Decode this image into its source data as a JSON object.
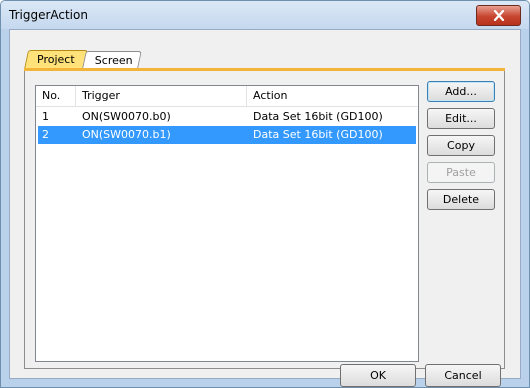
{
  "window": {
    "title": "TriggerAction"
  },
  "tabs": [
    {
      "label": "Project"
    },
    {
      "label": "Screen"
    }
  ],
  "table": {
    "columns": [
      "No.",
      "Trigger",
      "Action"
    ],
    "rows": [
      {
        "no": "1",
        "trigger": "ON(SW0070.b0)",
        "action": "Data Set 16bit (GD100)"
      },
      {
        "no": "2",
        "trigger": "ON(SW0070.b1)",
        "action": "Data Set 16bit (GD100)"
      }
    ],
    "selected_row": 2
  },
  "side_buttons": {
    "add": "Add...",
    "edit": "Edit...",
    "copy": "Copy",
    "paste": "Paste",
    "delete": "Delete"
  },
  "footer": {
    "ok": "OK",
    "cancel": "Cancel"
  },
  "colors": {
    "selection": "#3399ff",
    "tab_active": "#ffe27a",
    "tab_line": "#f2b53a",
    "close": "#c7452f"
  }
}
